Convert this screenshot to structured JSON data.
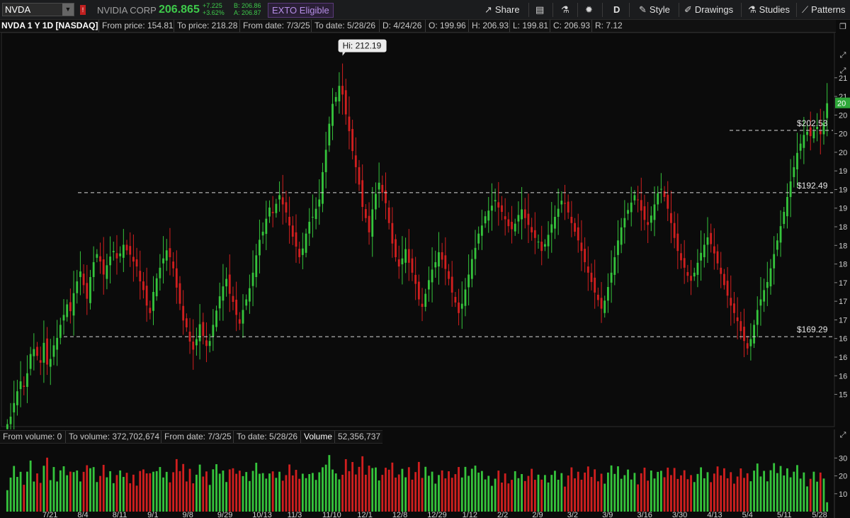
{
  "header": {
    "symbol": "NVDA",
    "company": "NVIDIA CORP",
    "last_price": "206.865",
    "change_abs": "+7.225",
    "change_pct": "+3.62%",
    "bid": "B: 206.86",
    "ask": "A: 206.87",
    "exto_label": "EXTO Eligible",
    "buttons": {
      "share": "Share",
      "aggregation": "D",
      "style": "Style",
      "drawings": "Drawings",
      "studies": "Studies",
      "patterns": "Patterns"
    },
    "icons": [
      "share-icon",
      "book-icon",
      "flask-icon",
      "gear-icon",
      "style-icon",
      "drawings-icon",
      "studies-icon",
      "patterns-icon"
    ]
  },
  "info_bar": {
    "title": "NVDA 1 Y 1D [NASDAQ]",
    "from_price": "From price: 154.81",
    "to_price": "To price: 218.28",
    "from_date": "From date: 7/3/25",
    "to_date": "To date: 5/28/26",
    "d": "D: 4/24/26",
    "o": "O: 199.96",
    "h": "H: 206.93",
    "l": "L: 199.81",
    "c": "C: 206.93",
    "r": "R: 7.12"
  },
  "volume_bar": {
    "from_volume": "From volume: 0",
    "to_volume": "To volume: 372,702,674",
    "from_date": "From date: 7/3/25",
    "to_date": "To date: 5/28/26",
    "label": "Volume",
    "value": "52,356,737"
  },
  "colors": {
    "up": "#35c43c",
    "down": "#d11f1f",
    "background": "#0b0b0b",
    "price_tag": "#2fa83a"
  },
  "chart_data": [
    {
      "type": "candlestick",
      "ylim": [
        154.81,
        218.28
      ],
      "hi_label": "Hi: 212.19",
      "levels": [
        {
          "value": 202.53,
          "label": "$202.53"
        },
        {
          "value": 192.49,
          "label": "$192.49"
        },
        {
          "value": 169.29,
          "label": "$169.29"
        }
      ],
      "y_ticks": [
        {
          "value": 211,
          "label": "21"
        },
        {
          "value": 208,
          "label": "21"
        },
        {
          "value": 205,
          "label": "20"
        },
        {
          "value": 202,
          "label": "20"
        },
        {
          "value": 199,
          "label": "20"
        },
        {
          "value": 196,
          "label": "19"
        },
        {
          "value": 193,
          "label": "19"
        },
        {
          "value": 190,
          "label": "19"
        },
        {
          "value": 187,
          "label": "18"
        },
        {
          "value": 184,
          "label": "18"
        },
        {
          "value": 181,
          "label": "18"
        },
        {
          "value": 178,
          "label": "17"
        },
        {
          "value": 175,
          "label": "17"
        },
        {
          "value": 172,
          "label": "17"
        },
        {
          "value": 169,
          "label": "16"
        },
        {
          "value": 166,
          "label": "16"
        },
        {
          "value": 163,
          "label": "16"
        },
        {
          "value": 160,
          "label": "15"
        }
      ],
      "price_tag": "20",
      "x_ticks": [
        "7/21",
        "8/4",
        "8/11",
        "9/1",
        "9/8",
        "9/29",
        "10/13",
        "11/3",
        "11/10",
        "12/1",
        "12/8",
        "12/29",
        "1/12",
        "2/2",
        "2/9",
        "3/2",
        "3/9",
        "3/16",
        "3/30",
        "4/13",
        "5/4",
        "5/11",
        "5/28"
      ],
      "closes": [
        155.2,
        156.4,
        158.6,
        160.5,
        162.1,
        161.2,
        163.4,
        166.5,
        167.3,
        166.2,
        165.1,
        168.3,
        164.8,
        165.7,
        167.9,
        169.1,
        171.2,
        172.8,
        174.5,
        173.4,
        176.3,
        178.2,
        179.8,
        177.6,
        175.4,
        178.9,
        181.3,
        182.6,
        181.4,
        179.3,
        180.8,
        182.2,
        183.1,
        181.9,
        182.7,
        184.1,
        183.2,
        182.5,
        181.4,
        180.6,
        178.2,
        176.8,
        174.3,
        173.1,
        176.5,
        178.7,
        180.4,
        181.9,
        183.2,
        182.1,
        180.3,
        177.2,
        174.6,
        171.9,
        170.8,
        168.5,
        167.2,
        168.9,
        171.3,
        169.4,
        167.8,
        168.6,
        171.2,
        173.5,
        175.8,
        177.4,
        178.6,
        176.2,
        174.9,
        172.8,
        171.4,
        173.6,
        175.3,
        177.1,
        179.6,
        182.4,
        184.9,
        186.2,
        188.3,
        190.1,
        189.2,
        190.7,
        192.1,
        190.6,
        189.3,
        187.2,
        185.4,
        183.8,
        182.1,
        183.5,
        185.9,
        187.8,
        188.6,
        189.9,
        191.4,
        195.8,
        199.4,
        203.6,
        206.8,
        207.9,
        209.7,
        208.3,
        205.1,
        202.4,
        199.2,
        196.6,
        193.8,
        190.2,
        188.4,
        186.1,
        189.8,
        192.3,
        194.1,
        192.5,
        190.8,
        187.6,
        184.3,
        182.1,
        180.6,
        181.9,
        183.4,
        181.2,
        179.6,
        177.8,
        175.3,
        174.1,
        176.2,
        178.4,
        180.1,
        181.3,
        182.9,
        181.7,
        180.2,
        178.6,
        176.4,
        174.8,
        173.1,
        174.6,
        176.9,
        179.3,
        181.8,
        183.6,
        185.9,
        187.2,
        188.7,
        189.6,
        190.4,
        191.3,
        190.1,
        189.4,
        188.2,
        187.1,
        186.6,
        187.5,
        188.9,
        189.8,
        188.4,
        187.3,
        186.1,
        185.2,
        184.6,
        183.1,
        184.2,
        185.7,
        187.4,
        188.6,
        189.9,
        191.2,
        190.7,
        189.3,
        187.6,
        186.2,
        184.8,
        183.1,
        181.3,
        179.6,
        178.1,
        176.4,
        175.2,
        173.8,
        175.1,
        177.3,
        179.6,
        182.1,
        184.8,
        186.9,
        188.4,
        189.7,
        190.9,
        192.1,
        191.3,
        189.6,
        188.1,
        187.3,
        188.8,
        190.6,
        192.4,
        193.1,
        191.8,
        189.9,
        187.6,
        185.2,
        183.1,
        181.6,
        180.4,
        179.1,
        178.3,
        179.6,
        181.2,
        182.8,
        184.1,
        185.3,
        184.2,
        182.7,
        181.1,
        179.4,
        177.6,
        175.9,
        174.3,
        173.1,
        171.8,
        170.2,
        168.6,
        167.4,
        168.9,
        171.2,
        173.6,
        175.3,
        176.8,
        178.1,
        180.3,
        182.6,
        184.8,
        187.1,
        189.4,
        191.8,
        194.3,
        196.6,
        198.9,
        200.4,
        201.8,
        202.3,
        201.6,
        202.4,
        203.1,
        201.9,
        203.8,
        206.9
      ]
    },
    {
      "type": "bar",
      "series_name": "Volume",
      "ylim": [
        0,
        372702674
      ],
      "y_ticks": [
        {
          "value": 100000000,
          "label": "10"
        },
        {
          "value": 200000000,
          "label": "20"
        },
        {
          "value": 300000000,
          "label": "30"
        }
      ],
      "last_value": 52356737
    }
  ]
}
